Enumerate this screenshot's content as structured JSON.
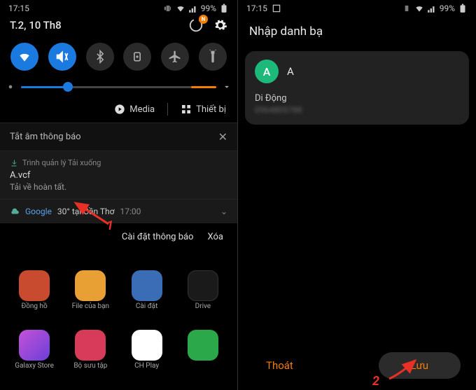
{
  "left": {
    "status": {
      "time": "17:15",
      "battery": "99%"
    },
    "date": "T.2, 10 Th8",
    "ring_badge": "N",
    "brightness_percent": 24,
    "media_label": "Media",
    "devices_label": "Thiết bị",
    "silent_header": "Tắt âm thông báo",
    "download": {
      "source": "Trình quản lý Tải xuống",
      "file": "A.vcf",
      "status": "Tải về hoàn tất."
    },
    "weather": {
      "provider": "Google",
      "text": "30° tại Cần Thơ",
      "time": "17:00"
    },
    "actions": {
      "settings": "Cài đặt thông báo",
      "clear": "Xóa"
    },
    "apps": [
      {
        "label": "Đồng hồ"
      },
      {
        "label": "File của bạn"
      },
      {
        "label": "Cài đặt"
      },
      {
        "label": "Drive"
      },
      {
        "label": "Galaxy Store"
      },
      {
        "label": "Bộ sưu tập"
      },
      {
        "label": "CH Play"
      },
      {
        "label": ""
      }
    ],
    "annotation": "1"
  },
  "right": {
    "status": {
      "time": "17:15",
      "battery": "99%"
    },
    "title": "Nhập danh bạ",
    "contact": {
      "initial": "A",
      "name": "A",
      "field_label": "Di Động",
      "number": "0964805788"
    },
    "actions": {
      "exit": "Thoát",
      "save": "Lưu"
    },
    "annotation": "2"
  }
}
